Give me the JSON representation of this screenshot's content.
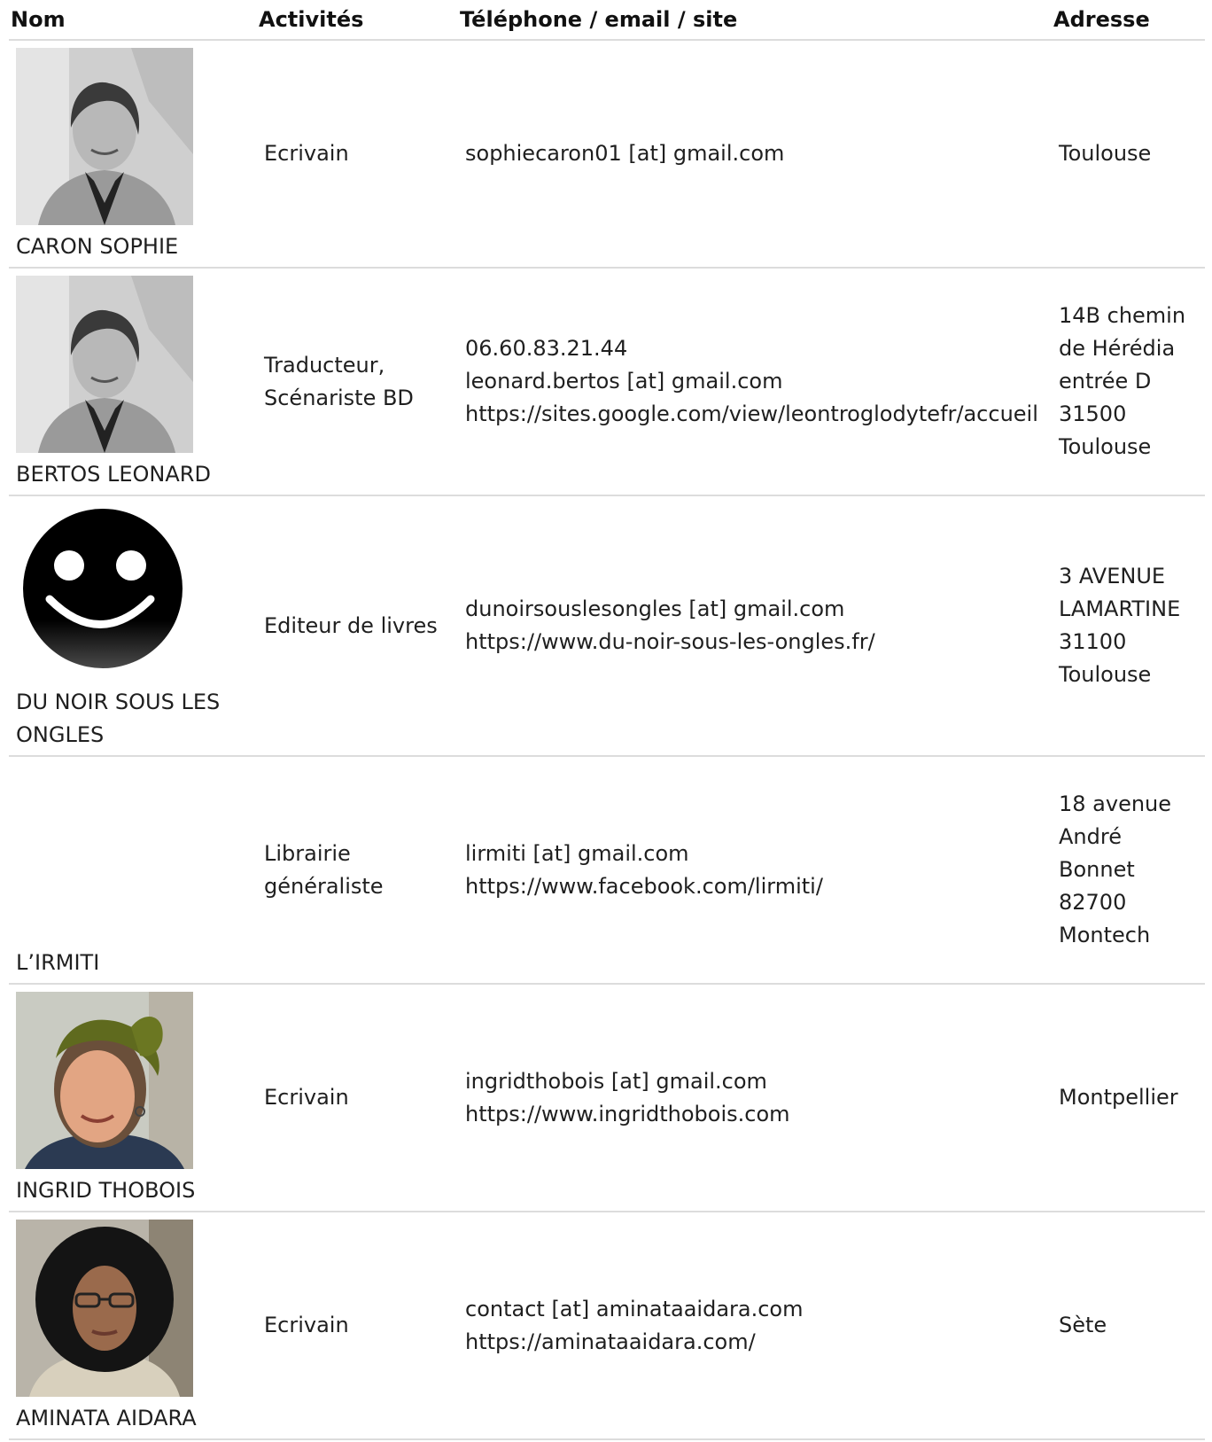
{
  "header": {
    "col_name": "Nom",
    "col_activities": "Activités",
    "col_contact": "Téléphone / email / site",
    "col_address": "Adresse"
  },
  "rows": [
    {
      "name": "CARON SOPHIE",
      "photo": "woman-portrait-grayscale",
      "activities": [
        "Ecrivain"
      ],
      "contact": [
        "sophiecaron01 [at] gmail.com"
      ],
      "address": [
        "Toulouse"
      ]
    },
    {
      "name": "BERTOS LEONARD",
      "photo": "woman-portrait-grayscale",
      "activities": [
        "Traducteur,",
        "Scénariste BD"
      ],
      "contact": [
        "06.60.83.21.44",
        "leonard.bertos [at] gmail.com",
        "https://sites.google.com/view/leontroglodytefr/accueil"
      ],
      "address": [
        "14B chemin",
        "de Hérédia",
        "entrée D",
        "31500",
        "Toulouse"
      ]
    },
    {
      "name": "DU NOIR SOUS LES ONGLES",
      "photo": "smiley-logo",
      "activities": [
        "Editeur de livres"
      ],
      "contact": [
        "dunoirsouslesongles [at] gmail.com",
        "https://www.du-noir-sous-les-ongles.fr/"
      ],
      "address": [
        "3 AVENUE",
        "LAMARTINE",
        "31100",
        "Toulouse"
      ]
    },
    {
      "name": "L’IRMITI",
      "photo": "",
      "activities": [
        "Librairie",
        "généraliste"
      ],
      "contact": [
        "lirmiti [at] gmail.com",
        "https://www.facebook.com/lirmiti/"
      ],
      "address": [
        "18 avenue",
        "André Bonnet",
        "82700",
        "Montech"
      ]
    },
    {
      "name": "INGRID THOBOIS",
      "photo": "woman-portrait-green-headband",
      "activities": [
        "Ecrivain"
      ],
      "contact": [
        "ingridthobois [at] gmail.com",
        "https://www.ingridthobois.com"
      ],
      "address": [
        "Montpellier"
      ]
    },
    {
      "name": "AMINATA AIDARA",
      "photo": "woman-portrait-curly-hair",
      "activities": [
        "Ecrivain"
      ],
      "contact": [
        "contact [at] aminataaidara.com",
        "https://aminataaidara.com/"
      ],
      "address": [
        "Sète"
      ]
    }
  ]
}
